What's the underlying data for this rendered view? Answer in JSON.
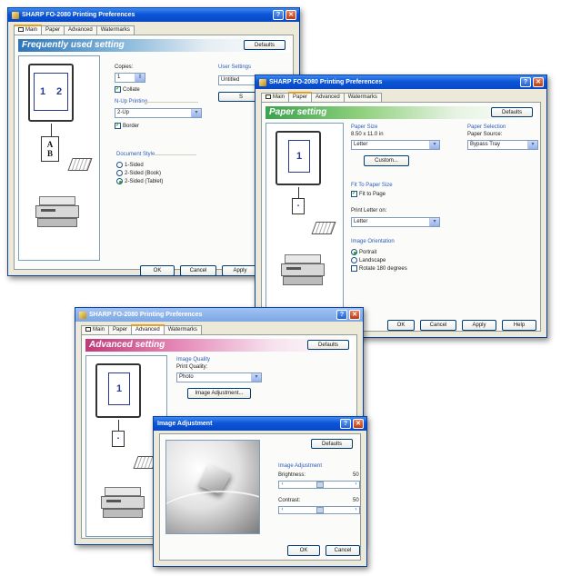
{
  "main_window": {
    "title": "SHARP FO-2080 Printing Preferences",
    "tabs": [
      "Main",
      "Paper",
      "Advanced",
      "Watermarks"
    ],
    "banner": "Frequently used setting",
    "defaults_label": "Defaults",
    "copies_label": "Copies:",
    "copies_value": "1",
    "collate_label": "Collate",
    "nup_group": "N-Up Printing",
    "nup_value": "2-Up",
    "border_label": "Border",
    "doc_style_group": "Document Style",
    "doc_style_options": [
      "1-Sided",
      "2-Sided (Book)",
      "2-Sided (Tablet)"
    ],
    "user_settings_label": "User Settings",
    "user_settings_value": "Untitled",
    "save_partial": "S",
    "preview_pages": [
      "1",
      "2"
    ],
    "ab_letters": [
      "A",
      "B"
    ],
    "ok_label": "OK",
    "cancel_label": "Cancel",
    "apply_label": "Apply"
  },
  "paper_window": {
    "title": "SHARP FO-2080 Printing Preferences",
    "tabs": [
      "Main",
      "Paper",
      "Advanced",
      "Watermarks"
    ],
    "banner": "Paper setting",
    "defaults_label": "Defaults",
    "paper_size_group": "Paper Size",
    "paper_size_dims": "8.50 x 11.0 in",
    "paper_size_value": "Letter",
    "custom_label": "Custom...",
    "fit_group": "Fit To Paper Size",
    "fit_label": "Fit to Page",
    "print_letter_on": "Print Letter on:",
    "print_letter_value": "Letter",
    "orientation_group": "Image Orientation",
    "orientation_options": [
      "Portrait",
      "Landscape"
    ],
    "rotate_label": "Rotate 180 degrees",
    "paper_selection_group": "Paper Selection",
    "paper_source_label": "Paper Source:",
    "paper_source_value": "Bypass Tray",
    "preview_page": "1",
    "ok_label": "OK",
    "cancel_label": "Cancel",
    "apply_label": "Apply",
    "help_label": "Help"
  },
  "advanced_window": {
    "title": "SHARP FO-2080 Printing Preferences",
    "tabs": [
      "Main",
      "Paper",
      "Advanced",
      "Watermarks"
    ],
    "banner": "Advanced setting",
    "defaults_label": "Defaults",
    "image_quality_group": "Image Quality",
    "print_quality_label": "Print Quality:",
    "print_quality_value": "Photo",
    "image_adjustment_button": "Image Adjustment...",
    "preview_page": "1"
  },
  "image_adjustment_dialog": {
    "title": "Image Adjustment",
    "defaults_label": "Defaults",
    "group_label": "Image Adjustment",
    "brightness_label": "Brightness:",
    "brightness_value": "50",
    "contrast_label": "Contrast:",
    "contrast_value": "50",
    "ok_label": "OK",
    "cancel_label": "Cancel"
  },
  "colors": {
    "xp_title_blue": "#0c55d8",
    "dialog_face": "#ece9d8",
    "check_green": "#21a121"
  },
  "icons": [
    "printer-icon",
    "help-icon",
    "close-icon",
    "dropdown-arrow-icon",
    "spinner-icon"
  ]
}
